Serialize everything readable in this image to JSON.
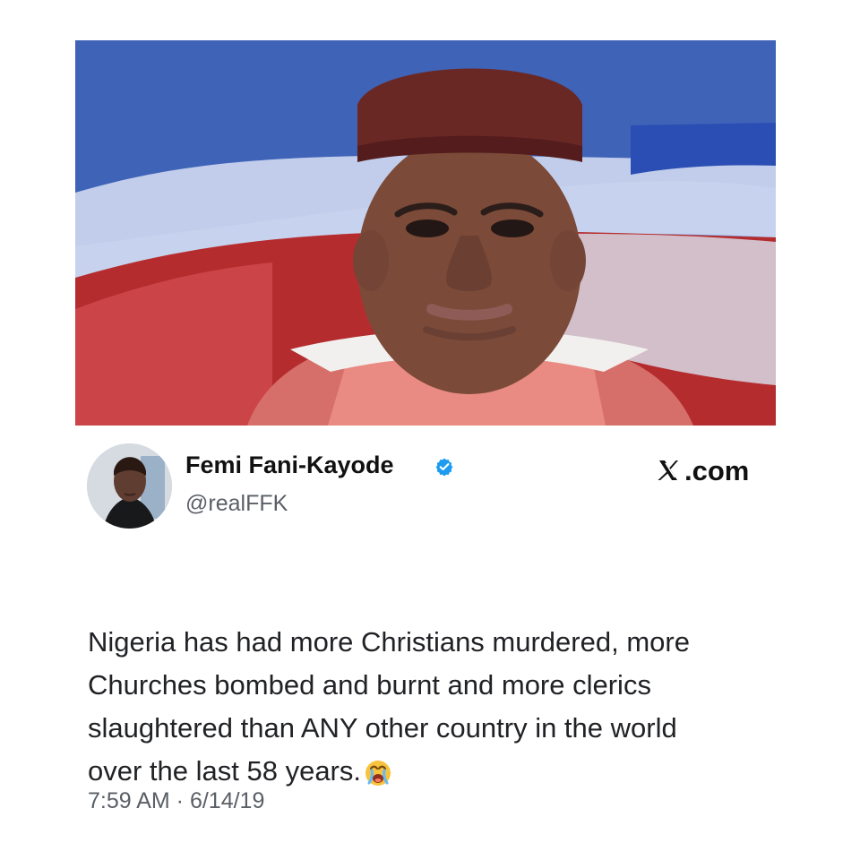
{
  "post": {
    "author": {
      "display_name": "Femi Fani-Kayode",
      "handle": "@realFFK",
      "verified": true,
      "verified_color": "#1d9bf0"
    },
    "brand": {
      "icon": "x-logo-icon",
      "label": ".com"
    },
    "text": "Nigeria has had more Christians murdered, more\nChurches bombed and burnt and more clerics\nslaughtered than ANY other country in the world\nover the last 58 years.",
    "emoji": "crying-face-icon",
    "timestamp": "7:59 AM · 6/14/19"
  }
}
